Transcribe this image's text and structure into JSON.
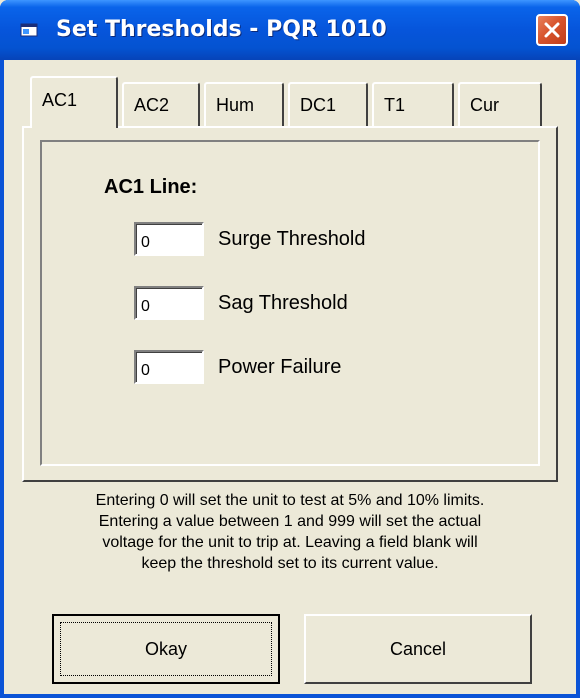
{
  "window": {
    "title": "Set Thresholds - PQR 1010",
    "icon": "app-window-icon",
    "close_icon": "close-icon"
  },
  "tabs": [
    {
      "label": "AC1",
      "active": true
    },
    {
      "label": "AC2",
      "active": false
    },
    {
      "label": "Hum",
      "active": false
    },
    {
      "label": "DC1",
      "active": false
    },
    {
      "label": "T1",
      "active": false
    },
    {
      "label": "Cur",
      "active": false
    }
  ],
  "panel": {
    "heading": "AC1 Line:",
    "fields": [
      {
        "label": "Surge Threshold",
        "value": "0"
      },
      {
        "label": "Sag Threshold",
        "value": "0"
      },
      {
        "label": "Power Failure",
        "value": "0"
      }
    ]
  },
  "info_lines": [
    "Entering 0 will set the unit to test at 5% and 10% limits.",
    "Entering a value between 1 and 999 will set the actual",
    "voltage for the unit to trip at.  Leaving a field blank will",
    "keep the threshold set to its current value."
  ],
  "buttons": {
    "okay": "Okay",
    "cancel": "Cancel"
  },
  "colors": {
    "titlebar": "#0655DB",
    "close": "#D8552E",
    "face": "#ECE9D8"
  }
}
